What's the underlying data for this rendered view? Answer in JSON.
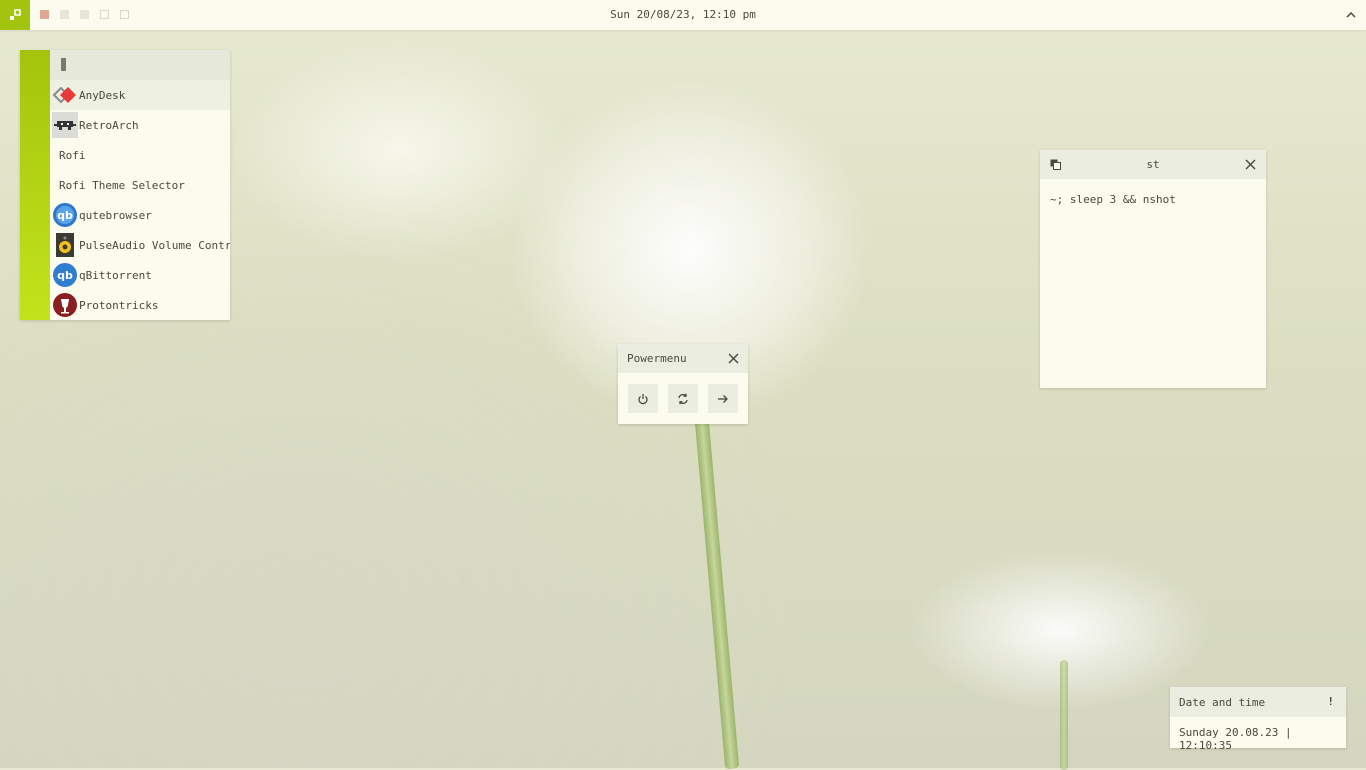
{
  "topbar": {
    "clock": "Sun 20/08/23, 12:10 pm",
    "workspaces": [
      "active",
      "filled",
      "filled",
      "empty",
      "empty"
    ],
    "launcher_icon": "launcher-icon",
    "tray_icon": "chevron-up-icon",
    "accent": "#a3c40e"
  },
  "launcher": {
    "query": "",
    "items": [
      {
        "label": "AnyDesk",
        "icon": "anydesk-icon",
        "selected": true
      },
      {
        "label": "RetroArch",
        "icon": "retroarch-icon"
      },
      {
        "label": "Rofi",
        "icon": ""
      },
      {
        "label": "Rofi Theme Selector",
        "icon": ""
      },
      {
        "label": "qutebrowser",
        "icon": "qutebrowser-icon"
      },
      {
        "label": "PulseAudio Volume Control",
        "icon": "pulseaudio-icon"
      },
      {
        "label": "qBittorrent",
        "icon": "qbittorrent-icon"
      },
      {
        "label": "Protontricks",
        "icon": "protontricks-icon"
      }
    ]
  },
  "terminal": {
    "title": "st",
    "command": "~; sleep 3 && nshot"
  },
  "powermenu": {
    "title": "Powermenu",
    "buttons": [
      "power-icon",
      "reboot-icon",
      "logout-icon"
    ]
  },
  "notification": {
    "title": "Date and time",
    "badge": "!",
    "body": "Sunday 20.08.23 | 12:10:35"
  }
}
